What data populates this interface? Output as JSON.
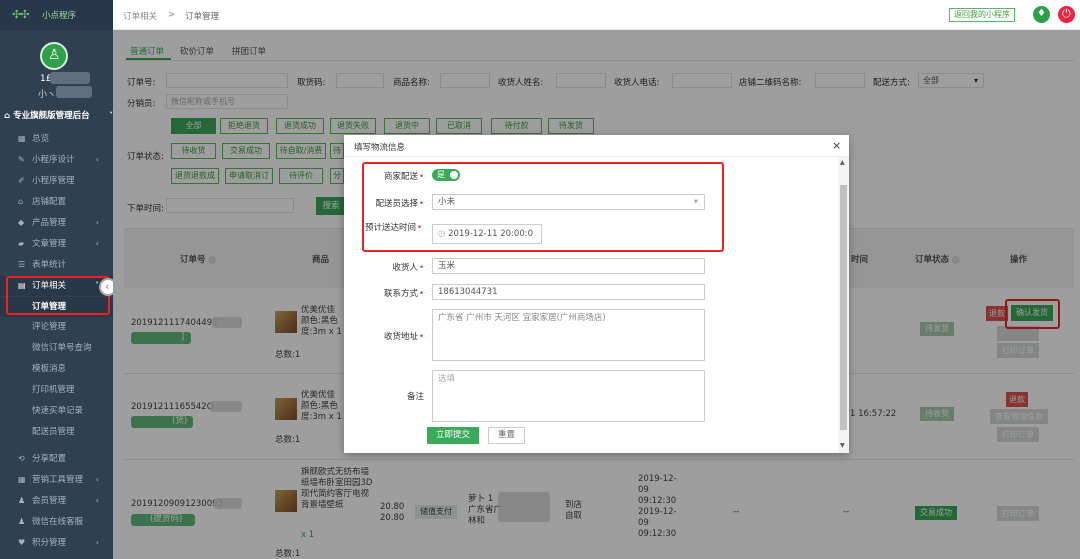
{
  "app": {
    "logo_text": "小点程序",
    "return_link": "返回我的小程序"
  },
  "breadcrumb": {
    "parent": "订单相关",
    "sep": ">",
    "current": "订单管理"
  },
  "user": {
    "id_prefix": "1£",
    "name_prefix": "小ヽ"
  },
  "sidebar": {
    "section": "专业旗舰版管理后台",
    "items": [
      {
        "label": "总览",
        "icon": "grid-icon"
      },
      {
        "label": "小程序设计",
        "icon": "pencil-icon",
        "expand": true
      },
      {
        "label": "小程序管理",
        "icon": "wrench-icon"
      },
      {
        "label": "店铺配置",
        "icon": "home-icon"
      },
      {
        "label": "产品管理",
        "icon": "tag-icon",
        "expand": true
      },
      {
        "label": "文章管理",
        "icon": "folder-icon",
        "expand": true
      },
      {
        "label": "表单统计",
        "icon": "list-icon"
      },
      {
        "label": "订单相关",
        "icon": "list-icon",
        "expand": true,
        "active": true
      },
      {
        "label": "订单管理",
        "sub": true,
        "active": true
      },
      {
        "label": "评论管理",
        "sub": true
      },
      {
        "label": "微信订单号查询",
        "sub": true
      },
      {
        "label": "模板消息",
        "sub": true
      },
      {
        "label": "打印机管理",
        "sub": true
      },
      {
        "label": "快速买单记录",
        "sub": true
      },
      {
        "label": "配送员管理",
        "sub": true
      },
      {
        "label": "分享配置",
        "icon": "share-icon"
      },
      {
        "label": "营销工具管理",
        "icon": "grid-icon",
        "expand": true
      },
      {
        "label": "会员管理",
        "icon": "user-icon",
        "expand": true
      },
      {
        "label": "微信在线客服",
        "icon": "user-icon"
      },
      {
        "label": "积分管理",
        "icon": "heart-icon",
        "expand": true
      }
    ]
  },
  "tabs": [
    "普通订单",
    "砍价订单",
    "拼团订单"
  ],
  "filters": {
    "order_no": "订单号:",
    "pickup_code": "取货码:",
    "product_name": "商品名称:",
    "receiver_name": "收货人姓名:",
    "receiver_phone": "收货人电话:",
    "store_qr": "店铺二维码名称:",
    "delivery_mode": "配送方式:",
    "delivery_mode_value": "全部",
    "distributor": "分销员:",
    "distributor_placeholder": "微信昵称或手机号",
    "status_label": "订单状态:",
    "time_label": "下单时间:",
    "search_btn": "搜索"
  },
  "status_buttons": {
    "row1": [
      "全部",
      "拒绝退货",
      "退货成功",
      "退货失败",
      "退货中",
      "已取消",
      "待付款",
      "待发货"
    ],
    "row2": [
      "待收货",
      "交易成功",
      "待自取/消费",
      "待"
    ],
    "row3": [
      "退货退款成",
      "申请取消订",
      "待评价",
      "分"
    ]
  },
  "table": {
    "headers": {
      "order_no": "订单号",
      "product": "商品",
      "time": "时间",
      "status": "订单状态",
      "action": "操作"
    },
    "rows": [
      {
        "order_no": "2019121117404493",
        "badge": "]",
        "product": "优美优佳\n颜色:黑色\n度:3m x 1",
        "total": "总数:1",
        "status": "待发货",
        "action_main": "确认发货",
        "action_refund": "退款",
        "action_print": "打印订单"
      },
      {
        "order_no": "20191211165542O",
        "badge": "(货)",
        "product": "优美优佳\n颜色:黑色\n度:3m x 1",
        "total": "总数:1",
        "time": "1 16:57:22",
        "status": "待收货",
        "action_refund": "退款",
        "action_logistics": "查看物流信息",
        "action_print": "打印订单"
      },
      {
        "order_no": "20191209091230093",
        "badge": "(提货码)",
        "product": "旗舰欧式无纺布墙纸墙布卧室田园3D现代简约客厅电视背景墙壁纸",
        "qty": "x 1",
        "total": "总数:1",
        "price": "20.80",
        "price2": "20.80",
        "pay": "储值支付",
        "receiver": "萝卜 1\n广东省广\n林和",
        "delivery": "到店\n自取",
        "time": "2019-12-\n09\n09:12:30\n2019-12-\n09\n09:12:30",
        "dash1": "--",
        "dash2": "--",
        "status": "交易成功",
        "action_print": "打印订单"
      }
    ]
  },
  "modal": {
    "title": "填写物流信息",
    "merchant_delivery_label": "商家配送",
    "merchant_delivery_toggle": "是",
    "courier_label": "配送员选择",
    "courier_value": "小未",
    "eta_label": "预计送达时间",
    "eta_value": "2019-12-11 20:00:0",
    "receiver_label": "收货人",
    "receiver_value": "玉米",
    "contact_label": "联系方式",
    "contact_value": "18613044731",
    "address_label": "收货地址",
    "address_value": "广东省 广州市 天河区 宜家家居(广州商场店)",
    "remark_label": "备注",
    "remark_placeholder": "选填",
    "submit": "立即提交",
    "reset": "重置"
  },
  "colors": {
    "sidebar": "#2f4050",
    "accent": "#3aa95a",
    "danger": "#e22222"
  }
}
